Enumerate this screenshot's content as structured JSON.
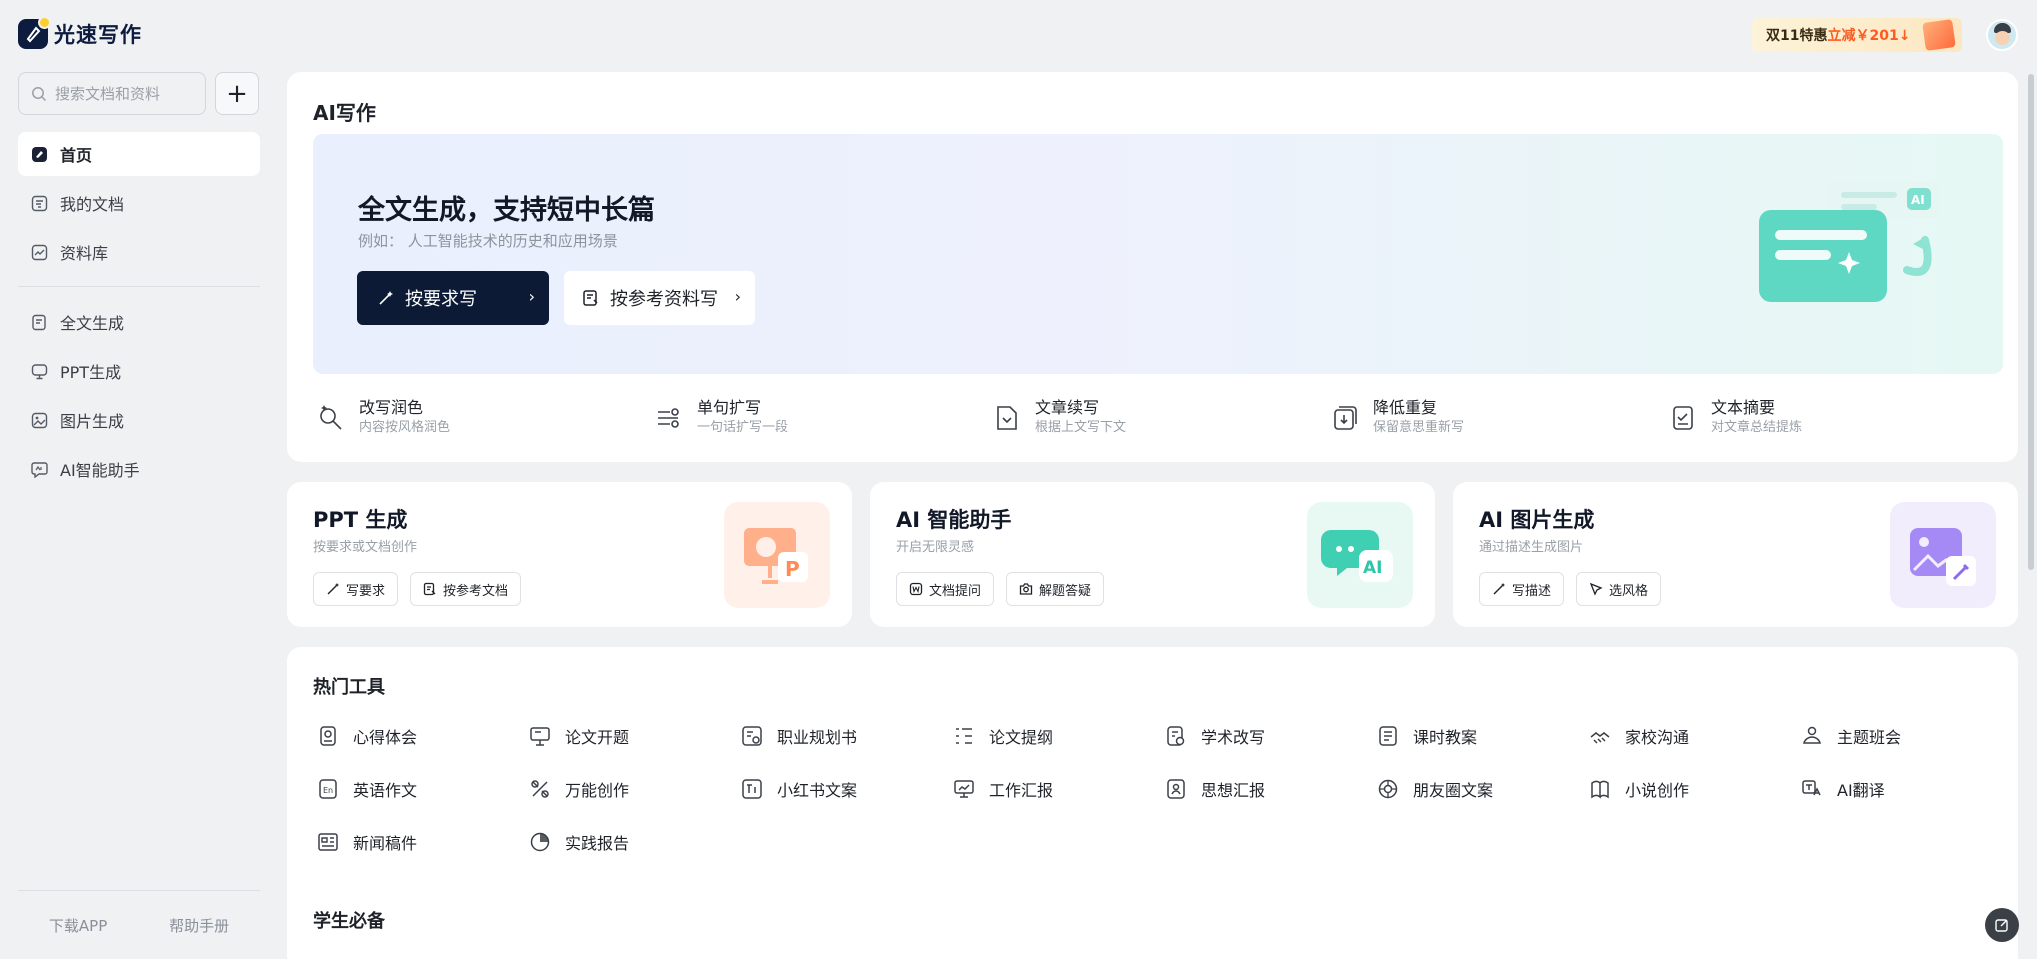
{
  "app": {
    "name": "光速写作"
  },
  "search": {
    "placeholder": "搜索文档和资料"
  },
  "nav": {
    "primary": [
      {
        "label": "首页",
        "icon": "home-icon",
        "active": true
      },
      {
        "label": "我的文档",
        "icon": "document-icon",
        "active": false
      },
      {
        "label": "资料库",
        "icon": "library-icon",
        "active": false
      }
    ],
    "secondary": [
      {
        "label": "全文生成",
        "icon": "fulltext-icon"
      },
      {
        "label": "PPT生成",
        "icon": "ppt-icon"
      },
      {
        "label": "图片生成",
        "icon": "image-icon"
      },
      {
        "label": "AI智能助手",
        "icon": "ai-chat-icon"
      }
    ]
  },
  "footer": {
    "download": "下载APP",
    "help": "帮助手册"
  },
  "promo": {
    "prefix": "双11特惠",
    "highlight": "立减￥201↓"
  },
  "ai_writing": {
    "title": "AI写作",
    "hero_title": "全文生成，支持短中长篇",
    "hero_example": "例如：  人工智能技术的历史和应用场景",
    "primary_btn": "按要求写",
    "secondary_btn": "按参考资料写",
    "tools": [
      {
        "name": "改写润色",
        "desc": "内容按风格润色",
        "icon": "polish-icon"
      },
      {
        "name": "单句扩写",
        "desc": "一句话扩写一段",
        "icon": "expand-icon"
      },
      {
        "name": "文章续写",
        "desc": "根据上文写下文",
        "icon": "continue-icon"
      },
      {
        "name": "降低重复",
        "desc": "保留意思重新写",
        "icon": "dedupe-icon"
      },
      {
        "name": "文本摘要",
        "desc": "对文章总结提炼",
        "icon": "summary-icon"
      }
    ]
  },
  "features": [
    {
      "title": "PPT 生成",
      "sub": "按要求或文档创作",
      "chips": [
        {
          "label": "写要求",
          "icon": "pen-icon"
        },
        {
          "label": "按参考文档",
          "icon": "doc-ref-icon"
        }
      ],
      "accent": "#ff8a55"
    },
    {
      "title": "AI 智能助手",
      "sub": "开启无限灵感",
      "chips": [
        {
          "label": "文档提问",
          "icon": "word-doc-icon"
        },
        {
          "label": "解题答疑",
          "icon": "camera-icon"
        }
      ],
      "accent": "#2fc5a8"
    },
    {
      "title": "AI 图片生成",
      "sub": "通过描述生成图片",
      "chips": [
        {
          "label": "写描述",
          "icon": "pen-icon"
        },
        {
          "label": "选风格",
          "icon": "brush-icon"
        }
      ],
      "accent": "#8b6cf0"
    }
  ],
  "hot_tools": {
    "title": "热门工具",
    "items": [
      {
        "label": "心得体会",
        "icon": "insight-icon"
      },
      {
        "label": "论文开题",
        "icon": "thesis-proposal-icon"
      },
      {
        "label": "职业规划书",
        "icon": "career-plan-icon"
      },
      {
        "label": "论文提纲",
        "icon": "outline-icon"
      },
      {
        "label": "学术改写",
        "icon": "academic-rewrite-icon"
      },
      {
        "label": "课时教案",
        "icon": "lesson-plan-icon"
      },
      {
        "label": "家校沟通",
        "icon": "handshake-icon"
      },
      {
        "label": "主题班会",
        "icon": "class-meeting-icon"
      },
      {
        "label": "英语作文",
        "icon": "english-essay-icon"
      },
      {
        "label": "万能创作",
        "icon": "universal-create-icon"
      },
      {
        "label": "小红书文案",
        "icon": "xiaohongshu-icon"
      },
      {
        "label": "工作汇报",
        "icon": "work-report-icon"
      },
      {
        "label": "思想汇报",
        "icon": "thought-report-icon"
      },
      {
        "label": "朋友圈文案",
        "icon": "moments-icon"
      },
      {
        "label": "小说创作",
        "icon": "novel-icon"
      },
      {
        "label": "AI翻译",
        "icon": "translate-icon"
      },
      {
        "label": "新闻稿件",
        "icon": "news-icon"
      },
      {
        "label": "实践报告",
        "icon": "practice-report-icon"
      }
    ]
  },
  "student": {
    "title": "学生必备"
  }
}
